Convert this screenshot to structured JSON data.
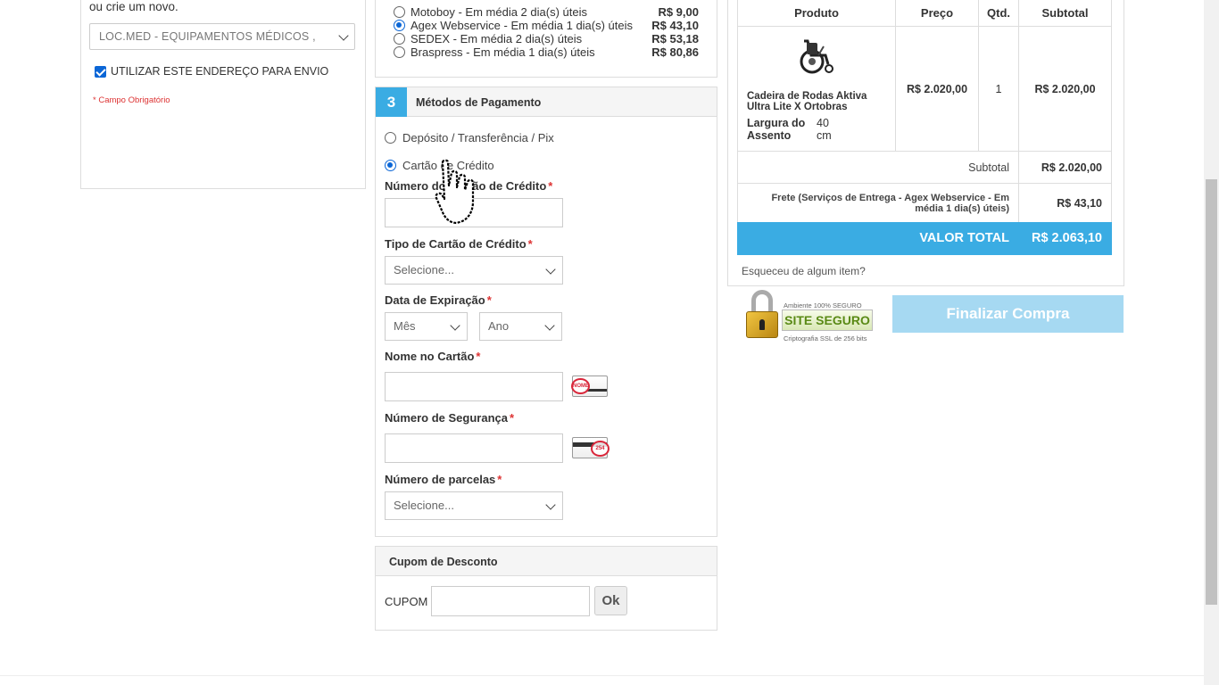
{
  "address": {
    "intro": "ou crie um novo.",
    "selected": "LOC.MED - EQUIPAMENTOS MÉDICOS ,",
    "use_for_shipping": "UTILIZAR ESTE ENDEREÇO PARA ENVIO",
    "required_note": "* Campo Obrigatório"
  },
  "shipping": {
    "options": [
      {
        "label": "Motoboy - Em média 2 dia(s) úteis",
        "price": "R$ 9,00",
        "selected": false
      },
      {
        "label": "Agex Webservice - Em média 1 dia(s) úteis",
        "price": "R$ 43,10",
        "selected": true
      },
      {
        "label": "SEDEX - Em média 2 dia(s) úteis",
        "price": "R$ 53,18",
        "selected": false
      },
      {
        "label": "Braspress - Em média 1 dia(s) úteis",
        "price": "R$ 80,86",
        "selected": false
      }
    ]
  },
  "payment": {
    "step": "3",
    "title": "Métodos de Pagamento",
    "options": [
      {
        "label": "Depósito / Transferência / Pix",
        "selected": false
      },
      {
        "label": "Cartão de Crédito",
        "selected": true
      }
    ],
    "card_number_label": "Número do Cartão de Crédito",
    "card_type_label": "Tipo de Cartão de Crédito",
    "card_type_placeholder": "Selecione...",
    "expiry_label": "Data de Expiração",
    "month_placeholder": "Mês",
    "year_placeholder": "Ano",
    "name_label": "Nome no Cartão",
    "name_hint_text": "NOME",
    "cvv_label": "Número de Segurança",
    "cvv_hint_text": "254",
    "installments_label": "Número de parcelas",
    "installments_placeholder": "Selecione...",
    "required_mark": "*"
  },
  "coupon": {
    "title": "Cupom de Desconto",
    "label": "CUPOM",
    "button": "Ok"
  },
  "summary": {
    "headers": [
      "Produto",
      "Preço",
      "Qtd.",
      "Subtotal"
    ],
    "product": {
      "name": "Cadeira de Rodas Aktiva Ultra Lite X Ortobras",
      "attr_name": "Largura do Assento",
      "attr_value": "40 cm",
      "price": "R$ 2.020,00",
      "qty": "1",
      "subtotal": "R$ 2.020,00"
    },
    "subtotal_label": "Subtotal",
    "subtotal_value": "R$ 2.020,00",
    "shipping_label": "Frete (Serviços de Entrega - Agex Webservice - Em média 1 dia(s) úteis)",
    "shipping_value": "R$ 43,10",
    "total_label": "VALOR TOTAL",
    "total_value": "R$ 2.063,10",
    "forgot": "Esqueceu de algum item?"
  },
  "secure_seal": {
    "top": "Ambiente 100% SEGURO",
    "badge": "SITE SEGURO",
    "bottom": "Criptografia SSL de 256 bits"
  },
  "finalize_button": "Finalizar Compra",
  "colors": {
    "accent": "#3aace3",
    "finalize_disabled": "#a6d9f2",
    "required": "#dd3333",
    "radio_checked": "#0b66d6"
  }
}
